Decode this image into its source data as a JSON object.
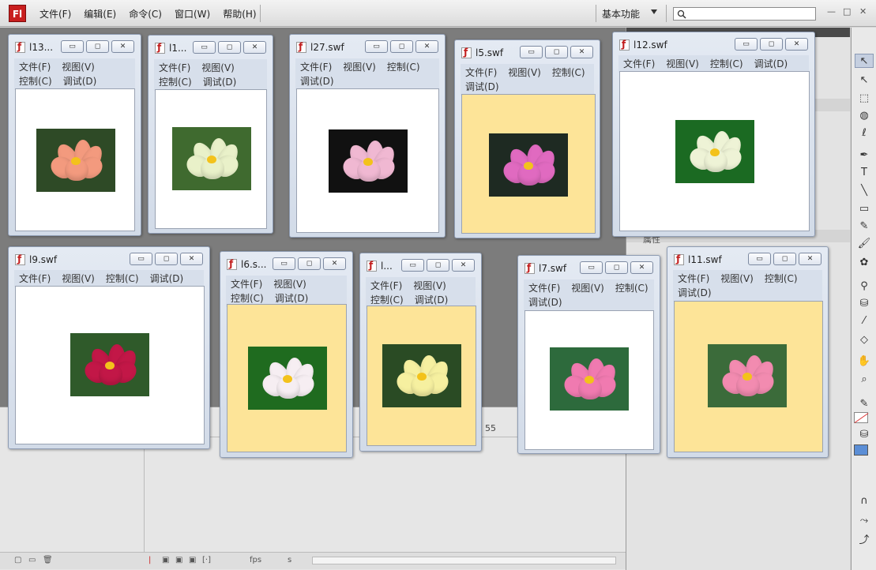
{
  "app": {
    "logo": "Fl",
    "menu": [
      "文件(F)",
      "编辑(E)",
      "命令(C)",
      "窗口(W)",
      "帮助(H)"
    ],
    "workspace_label": "基本功能",
    "search_placeholder": "",
    "window_controls": [
      "—",
      "□",
      "✕"
    ]
  },
  "timeline": {
    "ruler_mark": "55",
    "fps_label": "fps",
    "seconds_label": "s"
  },
  "panel": {
    "properties_label": "属性"
  },
  "tools": [
    "selection-icon",
    "subselection-icon",
    "free-transform-icon",
    "3d-rotation-icon",
    "lasso-icon",
    "pen-icon",
    "text-icon",
    "line-icon",
    "rectangle-icon",
    "pencil-icon",
    "brush-icon",
    "deco-icon",
    "bone-icon",
    "paint-bucket-icon",
    "eyedropper-icon",
    "eraser-icon",
    "hand-icon",
    "zoom-icon"
  ],
  "swf_windows": [
    {
      "title": "l13....",
      "menu": [
        "文件(F)",
        "视图(V)",
        "控制(C)",
        "调试(D)"
      ],
      "bg": "white",
      "flower": "#f39a7e"
    },
    {
      "title": "l1...",
      "menu": [
        "文件(F)",
        "视图(V)",
        "控制(C)",
        "调试(D)"
      ],
      "bg": "white",
      "flower": "#e9f1c9"
    },
    {
      "title": "l27.swf",
      "menu": [
        "文件(F)",
        "视图(V)",
        "控制(C)",
        "调试(D)"
      ],
      "bg": "white",
      "flower": "#f0b8d2"
    },
    {
      "title": "l5.swf",
      "menu": [
        "文件(F)",
        "视图(V)",
        "控制(C)",
        "调试(D)"
      ],
      "bg": "yellow",
      "flower": "#e06ac0"
    },
    {
      "title": "l12.swf",
      "menu": [
        "文件(F)",
        "视图(V)",
        "控制(C)",
        "调试(D)"
      ],
      "bg": "white",
      "flower": "#eef3d6"
    },
    {
      "title": "l9.swf",
      "menu": [
        "文件(F)",
        "视图(V)",
        "控制(C)",
        "调试(D)"
      ],
      "bg": "white",
      "flower": "#c21747"
    },
    {
      "title": "l6.s...",
      "menu": [
        "文件(F)",
        "视图(V)",
        "控制(C)",
        "调试(D)"
      ],
      "bg": "yellow",
      "flower": "#f6eef2"
    },
    {
      "title": "l...",
      "menu": [
        "文件(F)",
        "视图(V)",
        "控制(C)",
        "调试(D)"
      ],
      "bg": "yellow",
      "flower": "#f6f0a0"
    },
    {
      "title": "l7.swf",
      "menu": [
        "文件(F)",
        "视图(V)",
        "控制(C)",
        "调试(D)"
      ],
      "bg": "white",
      "flower": "#f07ab0"
    },
    {
      "title": "l11.swf",
      "menu": [
        "文件(F)",
        "视图(V)",
        "控制(C)",
        "调试(D)"
      ],
      "bg": "yellow",
      "flower": "#f28bb0"
    }
  ],
  "colors": {
    "accent": "#c81e1e",
    "stage_yellow": "#fde498",
    "fill": "#5b8ed6"
  }
}
